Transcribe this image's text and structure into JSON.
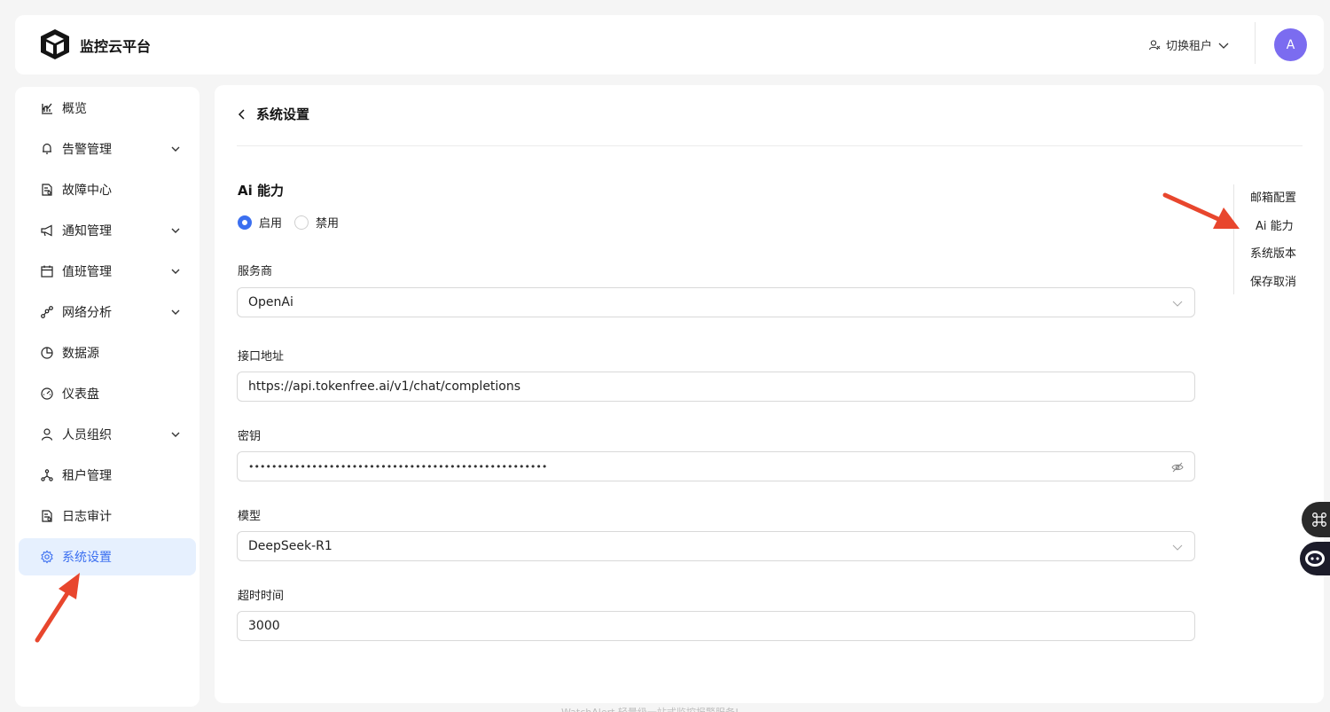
{
  "header": {
    "brand": "监控云平台",
    "tenant_label": "切换租户",
    "avatar_initial": "A"
  },
  "sidebar": {
    "items": [
      {
        "label": "概览",
        "icon": "chart-icon",
        "has_children": false
      },
      {
        "label": "告警管理",
        "icon": "bell-icon",
        "has_children": true
      },
      {
        "label": "故障中心",
        "icon": "document-icon",
        "has_children": false
      },
      {
        "label": "通知管理",
        "icon": "megaphone-icon",
        "has_children": true
      },
      {
        "label": "值班管理",
        "icon": "calendar-icon",
        "has_children": true
      },
      {
        "label": "网络分析",
        "icon": "network-icon",
        "has_children": true
      },
      {
        "label": "数据源",
        "icon": "pie-icon",
        "has_children": false
      },
      {
        "label": "仪表盘",
        "icon": "gauge-icon",
        "has_children": false
      },
      {
        "label": "人员组织",
        "icon": "user-icon",
        "has_children": true
      },
      {
        "label": "租户管理",
        "icon": "cluster-icon",
        "has_children": false
      },
      {
        "label": "日志审计",
        "icon": "document-icon",
        "has_children": false
      },
      {
        "label": "系统设置",
        "icon": "gear-icon",
        "has_children": false,
        "active": true
      }
    ]
  },
  "page": {
    "title": "系统设置",
    "section_title": "Ai 能力",
    "radio_enable": "启用",
    "radio_disable": "禁用",
    "selected": "启用",
    "provider_label": "服务商",
    "provider_value": "OpenAi",
    "endpoint_label": "接口地址",
    "endpoint_value": "https://api.tokenfree.ai/v1/chat/completions",
    "secret_label": "密钥",
    "secret_value": "••••••••••••••••••••••••••••••••••••••••••••••••••••",
    "model_label": "模型",
    "model_value": "DeepSeek-R1",
    "timeout_label": "超时时间",
    "timeout_value": "3000"
  },
  "anchor": {
    "items": [
      "邮箱配置",
      "Ai 能力",
      "系统版本",
      "保存取消"
    ]
  },
  "footer": {
    "text": "WatchAlert 轻量级一站式监控报警服务!"
  },
  "colors": {
    "accent": "#3b6ff0",
    "active_bg": "#e6f0fe",
    "avatar": "#7b6cf0",
    "arrow": "#e8462d"
  }
}
